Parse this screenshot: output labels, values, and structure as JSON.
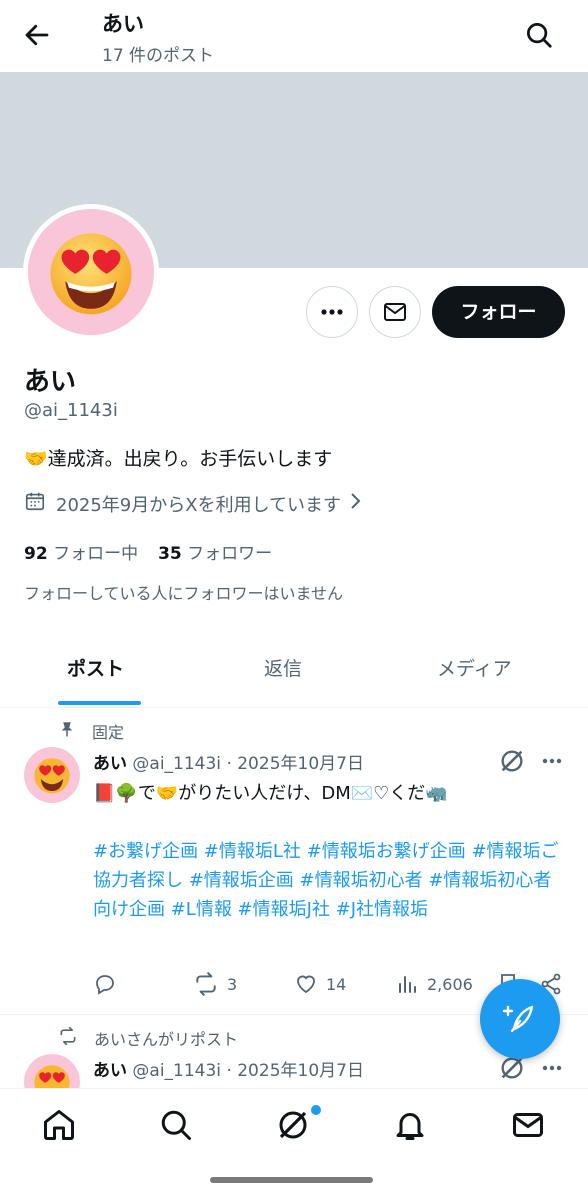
{
  "topbar": {
    "title": "あい",
    "subtitle": "17 件のポスト"
  },
  "profile": {
    "name": "あい",
    "handle": "@ai_1143i",
    "bio": "🤝達成済。出戻り。お手伝いします",
    "joined": "2025年9月からXを利用しています",
    "following_count": "92",
    "following_label": "フォロー中",
    "followers_count": "35",
    "followers_label": "フォロワー",
    "mutual_note": "フォローしている人にフォロワーはいません",
    "follow_button": "フォロー"
  },
  "tabs": [
    {
      "label": "ポスト",
      "active": true
    },
    {
      "label": "返信",
      "active": false
    },
    {
      "label": "メディア",
      "active": false
    }
  ],
  "posts": [
    {
      "context": "固定",
      "name": "あい",
      "meta": "@ai_1143i · 2025年10月7日",
      "text": "📕🌳で🤝がりたい人だけ、DM✉️♡くだ🦏",
      "hashtags": "#お繋げ企画 #情報垢L社 #情報垢お繋げ企画 #情報垢ご協力者探し #情報垢企画 #情報垢初心者 #情報垢初心者向け企画 #L情報 #情報垢J社 #J社情報垢",
      "replies": "",
      "reposts": "3",
      "likes": "14",
      "views": "2,606"
    },
    {
      "context": "あいさんがリポスト",
      "name": "あい",
      "meta": "@ai_1143i · 2025年10月7日"
    }
  ],
  "colors": {
    "accent": "#1d9bf0",
    "text": "#0f1419",
    "secondary": "#536471",
    "banner": "#cfd9de",
    "avatar_bg": "#f9c5d9"
  },
  "icons": {
    "back": "arrow-left-icon",
    "search": "search-icon",
    "more": "more-dots-icon",
    "dm": "mail-icon",
    "calendar": "calendar-icon",
    "pin": "pin-icon",
    "repost": "repost-icon",
    "grok": "grok-icon",
    "reply": "reply-icon",
    "like": "heart-icon",
    "views": "views-icon",
    "bookmark": "bookmark-icon",
    "share": "share-icon",
    "compose": "compose-icon",
    "home": "home-icon",
    "notifications": "bell-icon"
  }
}
